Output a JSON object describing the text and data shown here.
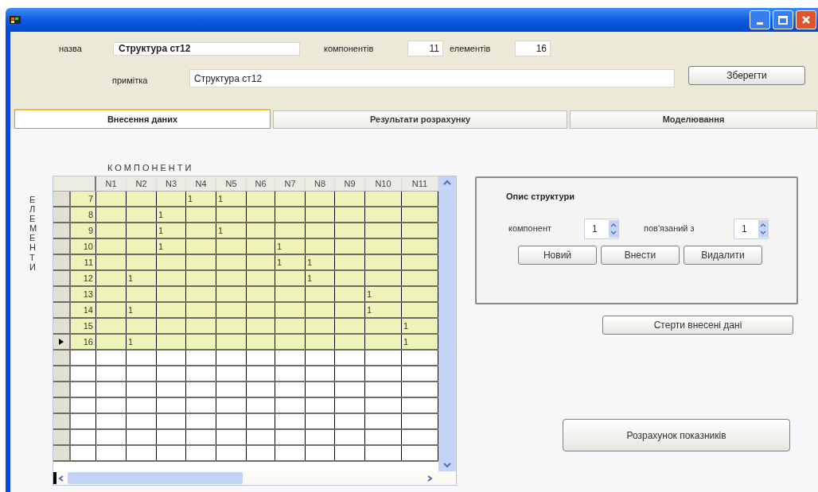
{
  "form": {
    "name_label": "назва",
    "name": "Структура ст12",
    "components_label": "компонентів",
    "components": "11",
    "elements_label": "елементів",
    "elements": "16",
    "note_label": "примітка",
    "note": "Структура ст12",
    "save_button": "Зберегти"
  },
  "tabs": [
    {
      "label": "Внесення даних",
      "selected": true
    },
    {
      "label": "Результати розрахунку",
      "selected": false
    },
    {
      "label": "Моделювання",
      "selected": false
    }
  ],
  "grid": {
    "top_label": "КОМПОНЕНТИ",
    "side_label": "ЕЛЕМЕНТИ",
    "columns": [
      "N1",
      "N2",
      "N3",
      "N4",
      "N5",
      "N6",
      "N7",
      "N8",
      "N9",
      "N10",
      "N11"
    ],
    "rows": [
      {
        "number": "7",
        "current": false,
        "cells": [
          null,
          null,
          null,
          "1",
          "1",
          null,
          null,
          null,
          null,
          null,
          null
        ]
      },
      {
        "number": "8",
        "current": false,
        "cells": [
          null,
          null,
          "1",
          null,
          null,
          null,
          null,
          null,
          null,
          null,
          null
        ]
      },
      {
        "number": "9",
        "current": false,
        "cells": [
          null,
          null,
          "1",
          null,
          "1",
          null,
          null,
          null,
          null,
          null,
          null
        ]
      },
      {
        "number": "10",
        "current": false,
        "cells": [
          null,
          null,
          "1",
          null,
          null,
          null,
          "1",
          null,
          null,
          null,
          null
        ]
      },
      {
        "number": "11",
        "current": false,
        "cells": [
          null,
          null,
          null,
          null,
          null,
          null,
          "1",
          "1",
          null,
          null,
          null
        ]
      },
      {
        "number": "12",
        "current": false,
        "cells": [
          null,
          "1",
          null,
          null,
          null,
          null,
          null,
          "1",
          null,
          null,
          null
        ]
      },
      {
        "number": "13",
        "current": false,
        "cells": [
          null,
          null,
          null,
          null,
          null,
          null,
          null,
          null,
          null,
          "1",
          null
        ]
      },
      {
        "number": "14",
        "current": false,
        "cells": [
          null,
          "1",
          null,
          null,
          null,
          null,
          null,
          null,
          null,
          "1",
          null
        ]
      },
      {
        "number": "15",
        "current": false,
        "cells": [
          null,
          null,
          null,
          null,
          null,
          null,
          null,
          null,
          null,
          null,
          "1"
        ]
      },
      {
        "number": "16",
        "current": true,
        "cells": [
          null,
          "1",
          null,
          null,
          null,
          null,
          null,
          null,
          null,
          null,
          "1"
        ]
      }
    ]
  },
  "structure_panel": {
    "title": "Опис структури",
    "component_label": "компонент",
    "component": "1",
    "linked_label": "пов'язаний з",
    "linked": "1",
    "buttons": [
      "Новий",
      "Внести",
      "Видалити"
    ]
  },
  "clear_button": "Стерти внесені дані",
  "calculate_button": "Розрахунок показників"
}
